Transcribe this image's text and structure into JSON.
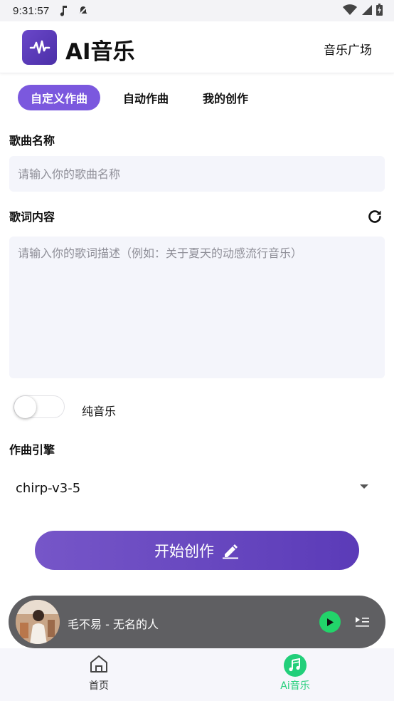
{
  "status_bar": {
    "time": "9:31:57"
  },
  "header": {
    "title": "AI音乐",
    "link": "音乐广场"
  },
  "tabs": [
    {
      "label": "自定义作曲",
      "active": true
    },
    {
      "label": "自动作曲",
      "active": false
    },
    {
      "label": "我的创作",
      "active": false
    }
  ],
  "song_name": {
    "label": "歌曲名称",
    "placeholder": "请输入你的歌曲名称",
    "value": ""
  },
  "lyrics": {
    "label": "歌词内容",
    "placeholder": "请输入你的歌词描述（例如：关于夏天的动感流行音乐）",
    "value": ""
  },
  "pure_music": {
    "label": "纯音乐",
    "enabled": false
  },
  "engine": {
    "label": "作曲引擎",
    "selected": "chirp-v3-5"
  },
  "start_button": {
    "label": "开始创作"
  },
  "player": {
    "track": "毛不易 - 无名的人"
  },
  "bottom_nav": [
    {
      "label": "首页",
      "icon": "home-icon",
      "active": false
    },
    {
      "label": "Ai音乐",
      "icon": "music-note-icon",
      "active": true
    }
  ],
  "colors": {
    "accent": "#7b58de",
    "nav_active": "#22cf7a",
    "play_green": "#22d46a"
  }
}
